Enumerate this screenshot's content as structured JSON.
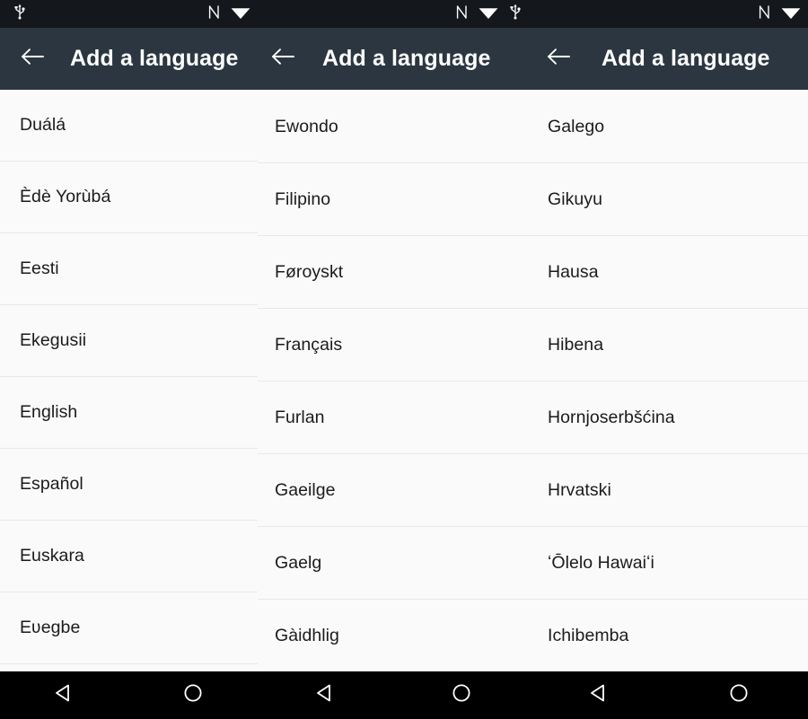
{
  "device": {
    "statusbar": {
      "icons_left": [
        "usb-icon"
      ],
      "icons_right": [
        "nfc-icon",
        "wifi-icon"
      ],
      "background": "#14181c"
    },
    "navbar": {
      "buttons": [
        "back-nav-icon",
        "home-nav-icon"
      ],
      "background": "#000000"
    }
  },
  "appbar": {
    "title": "Add a language",
    "back_icon": "arrow-left-icon",
    "background": "#2b3640",
    "text_color": "#ffffff"
  },
  "panels": [
    {
      "id": "panel-1",
      "statusbar_icons_left": [
        "usb-icon"
      ],
      "statusbar_icons_right": [
        "nfc-icon",
        "wifi-icon"
      ],
      "title": "Add a language",
      "languages": [
        "Duálá",
        "Èdè Yorùbá",
        "Eesti",
        "Ekegusii",
        "English",
        "Español",
        "Euskara",
        "Eʋegbe"
      ]
    },
    {
      "id": "panel-2",
      "statusbar_icons_left": [],
      "statusbar_icons_right": [
        "nfc-icon",
        "wifi-icon",
        "usb-icon"
      ],
      "title": "Add a language",
      "languages": [
        "Ewondo",
        "Filipino",
        "Føroyskt",
        "Français",
        "Furlan",
        "Gaeilge",
        "Gaelg",
        "Gàidhlig"
      ]
    },
    {
      "id": "panel-3",
      "statusbar_icons_left": [],
      "statusbar_icons_right": [
        "nfc-icon",
        "wifi-icon"
      ],
      "title": "Add a language",
      "languages": [
        "Galego",
        "Gikuyu",
        "Hausa",
        "Hibena",
        "Hornjoserbšćina",
        "Hrvatski",
        "ʻŌlelo Hawaiʻi",
        "Ichibemba"
      ]
    }
  ],
  "colors": {
    "list_background": "#fafafa",
    "list_divider": "#e8e8e8",
    "list_text": "#1b1b1b",
    "appbar": "#2b3640",
    "statusbar": "#14181c",
    "navbar": "#000000"
  }
}
